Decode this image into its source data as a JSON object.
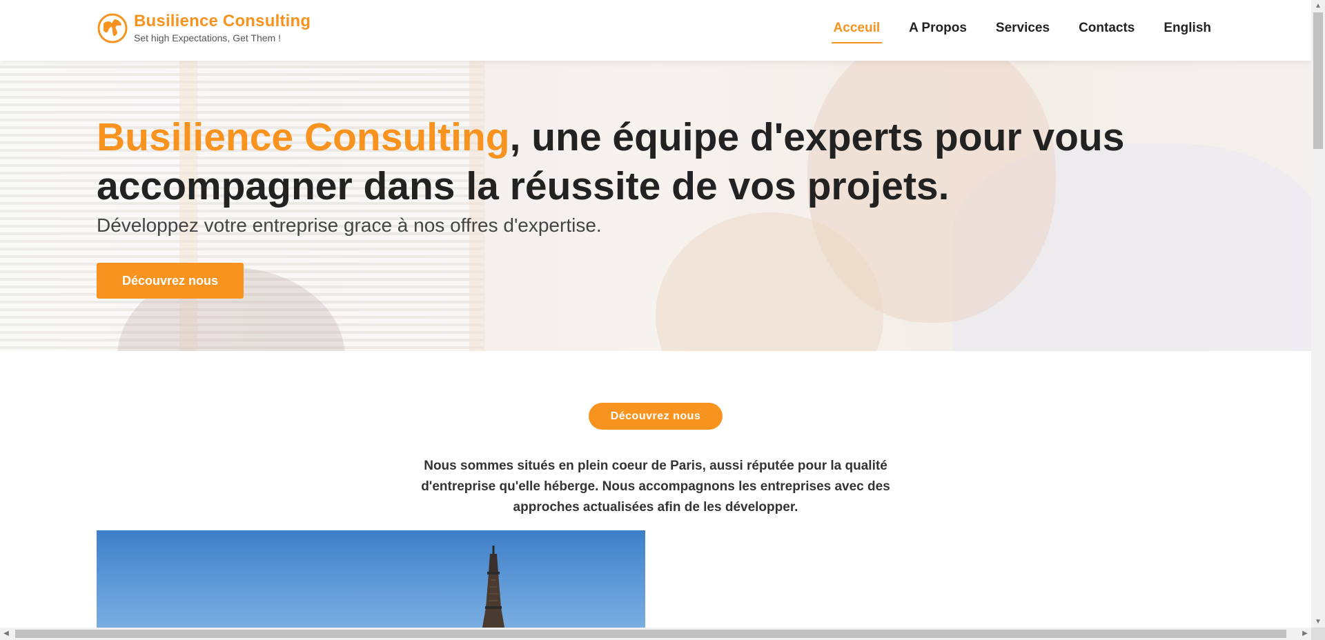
{
  "brand": {
    "name": "Busilience Consulting",
    "tagline": "Set high Expectations, Get Them !",
    "accent_color": "#f7931e",
    "logo_icon": "globe-icon"
  },
  "nav": {
    "items": [
      {
        "label": "Acceuil",
        "active": true
      },
      {
        "label": "A Propos"
      },
      {
        "label": "Services"
      },
      {
        "label": "Contacts"
      },
      {
        "label": "English"
      }
    ]
  },
  "hero": {
    "title_brand": "Busilience Consulting",
    "title_rest": ", une équipe d'experts pour vous accompagner dans la réussite de vos projets.",
    "subtitle": "Développez votre entreprise grace à nos offres d'expertise.",
    "cta": "Découvrez nous"
  },
  "about": {
    "pill": "Découvrez nous",
    "text": "Nous sommes situés en plein coeur de Paris, aussi réputée pour la qualité d'entreprise qu'elle héberge. Nous accompagnons les entreprises avec des approches actualisées afin de les développer."
  },
  "scrollbars": {
    "up_arrow": "▲",
    "down_arrow": "▼",
    "left_arrow": "◀",
    "right_arrow": "▶"
  }
}
